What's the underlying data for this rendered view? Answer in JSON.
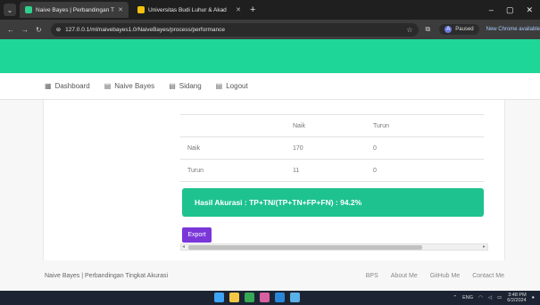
{
  "browser": {
    "tabs": [
      {
        "title": "Naive Bayes | Perbandingan Tin",
        "active": true,
        "favicon_color": "#2fcf8c"
      },
      {
        "title": "Universitas Budi Luhur & Akad",
        "active": false,
        "favicon_color": "#f4c20d"
      }
    ],
    "url": "127.0.0.1/ml/naivebayes1.0/NaiveBayes/process/performance",
    "profile_label": "Paused",
    "profile_initial": "A",
    "new_chrome_label": "New Chrome available"
  },
  "navbar": {
    "items": [
      {
        "label": "Dashboard",
        "icon": "dashboard-icon"
      },
      {
        "label": "Naive Bayes",
        "icon": "calendar-icon"
      },
      {
        "label": "Sidang",
        "icon": "calendar-icon"
      },
      {
        "label": "Logout",
        "icon": "calendar-icon"
      }
    ]
  },
  "table": {
    "headers": [
      "",
      "Naik",
      "Turun"
    ],
    "rows": [
      [
        "Naik",
        "170",
        "0"
      ],
      [
        "Turun",
        "11",
        "0"
      ]
    ]
  },
  "accuracy": {
    "text": "Hasil Akurasi : TP+TN/(TP+TN+FP+FN) : 94.2%"
  },
  "export_label": "Export",
  "footer": {
    "brand": "Naive Bayes | Perbandingan Tingkat Akurasi",
    "links": [
      "BPS",
      "About Me",
      "GitHub Me",
      "Contact Me"
    ]
  },
  "taskbar": {
    "lang": "ENG",
    "time": "3:48 PM",
    "date": "6/2/2024"
  },
  "colors": {
    "hero": "#1fd699",
    "accuracy_bg": "#1ec28f",
    "export_bg": "#7a36d9"
  }
}
